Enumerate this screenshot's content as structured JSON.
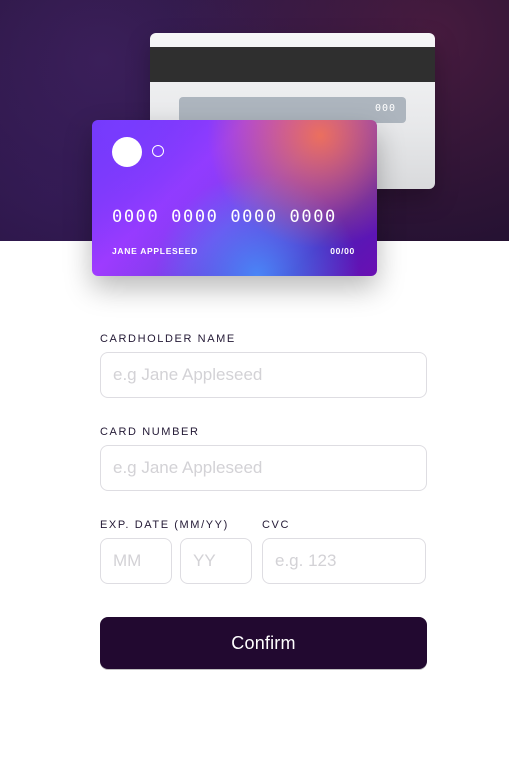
{
  "card_back": {
    "cvc": "000"
  },
  "card_front": {
    "number": "0000 0000 0000 0000",
    "name": "JANE APPLESEED",
    "expiry": "00/00"
  },
  "form": {
    "cardholder_label": "CARDHOLDER NAME",
    "cardholder_placeholder": "e.g Jane Appleseed",
    "cardholder_value": "",
    "number_label": "CARD NUMBER",
    "number_placeholder": "e.g Jane Appleseed",
    "number_value": "",
    "exp_label": "EXP. DATE (MM/YY)",
    "mm_placeholder": "MM",
    "yy_placeholder": "YY",
    "cvc_label": "CVC",
    "cvc_placeholder": "e.g. 123",
    "confirm_label": "Confirm"
  },
  "colors": {
    "button_background": "#220930",
    "label_text": "#231935",
    "placeholder_text": "#d3d2d6",
    "input_border": "#dedde2"
  }
}
